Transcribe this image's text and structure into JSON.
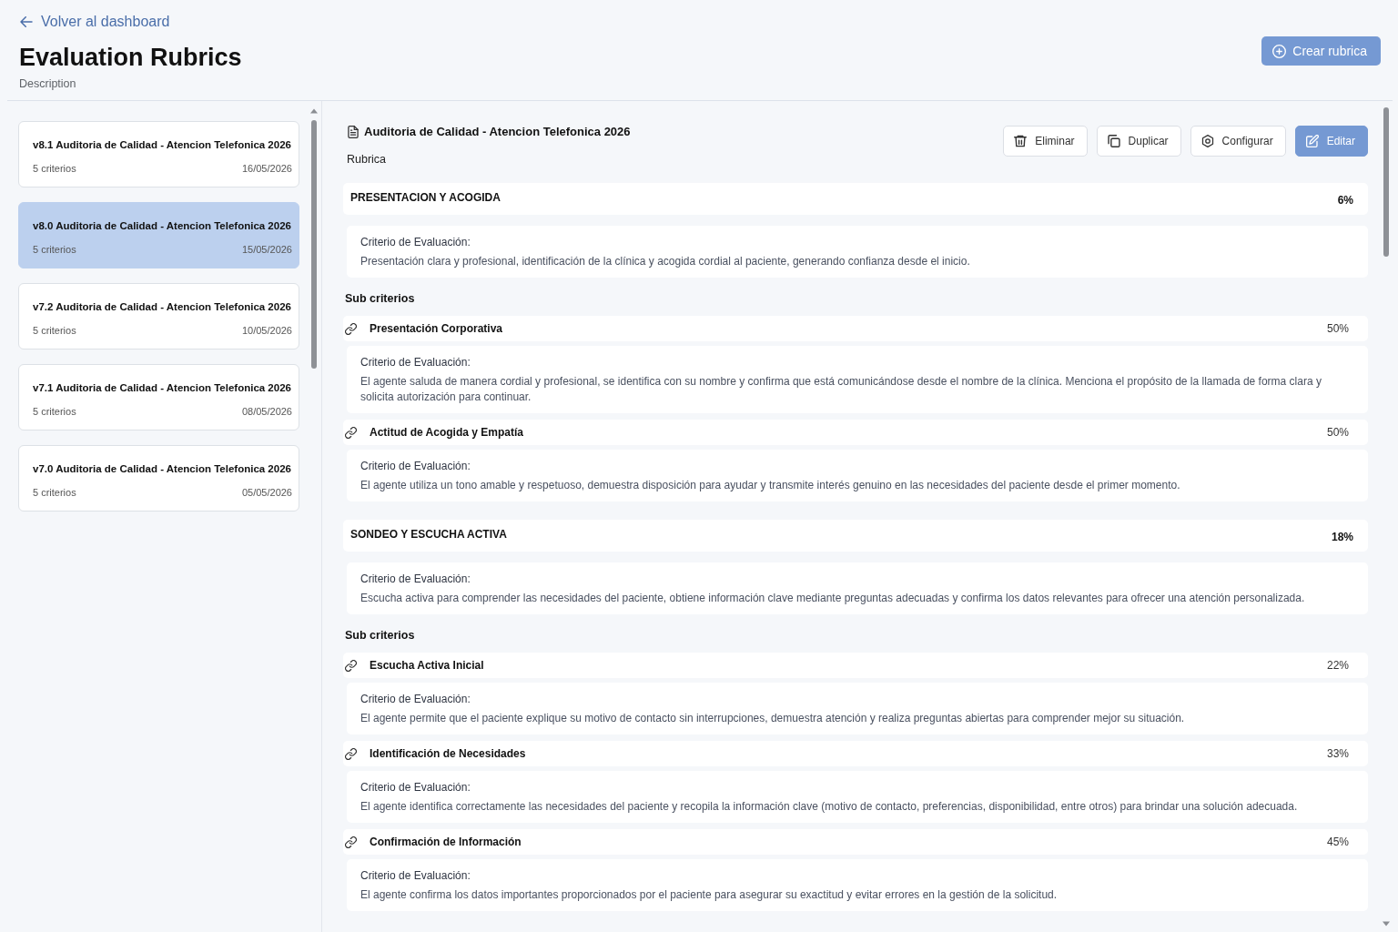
{
  "header": {
    "back_link": "Volver al dashboard",
    "title": "Evaluation Rubrics",
    "description": "Description",
    "create_button": "Crear rubrica"
  },
  "rubric_list": [
    {
      "title": "v8.1 Auditoria de Calidad - Atencion Telefonica 2026",
      "criteria_count": "5 criterios",
      "date": "16/05/2026",
      "selected": false
    },
    {
      "title": "v8.0 Auditoria de Calidad - Atencion Telefonica 2026",
      "criteria_count": "5 criterios",
      "date": "15/05/2026",
      "selected": true
    },
    {
      "title": "v7.2 Auditoria de Calidad - Atencion Telefonica 2026",
      "criteria_count": "5 criterios",
      "date": "10/05/2026",
      "selected": false
    },
    {
      "title": "v7.1 Auditoria de Calidad - Atencion Telefonica 2026",
      "criteria_count": "5 criterios",
      "date": "08/05/2026",
      "selected": false
    },
    {
      "title": "v7.0 Auditoria de Calidad - Atencion Telefonica 2026",
      "criteria_count": "5 criterios",
      "date": "05/05/2026",
      "selected": false
    }
  ],
  "detail": {
    "title": "Auditoria de Calidad - Atencion Telefonica 2026",
    "subtitle": "Rubrica",
    "actions": [
      {
        "label": "Eliminar",
        "kind": "delete",
        "primary": false
      },
      {
        "label": "Duplicar",
        "kind": "duplicate",
        "primary": false
      },
      {
        "label": "Configurar",
        "kind": "configure",
        "primary": false
      },
      {
        "label": "Editar",
        "kind": "edit",
        "primary": true
      }
    ],
    "criteria": [
      {
        "name": "PRESENTACION Y ACOGIDA",
        "weight": "6%",
        "criterion_label": "Criterio de Evaluación:",
        "criterion_text": "Presentación clara y profesional, identificación de la clínica y acogida cordial al paciente, generando confianza desde el inicio.",
        "subcriteria_heading": "Sub criterios",
        "subcriteria": [
          {
            "name": "Presentación Corporativa",
            "weight": "50%",
            "criterion_label": "Criterio de Evaluación:",
            "criterion_text": "El agente saluda de manera cordial y profesional, se identifica con su nombre y confirma que está comunicándose desde el nombre de la clínica. Menciona el propósito de la llamada de forma clara y solicita autorización para continuar."
          },
          {
            "name": "Actitud de Acogida y Empatía",
            "weight": "50%",
            "criterion_label": "Criterio de Evaluación:",
            "criterion_text": "El agente utiliza un tono amable y respetuoso, demuestra disposición para ayudar y transmite interés genuino en las necesidades del paciente desde el primer momento."
          }
        ]
      },
      {
        "name": "SONDEO Y ESCUCHA ACTIVA",
        "weight": "18%",
        "criterion_label": "Criterio de Evaluación:",
        "criterion_text": "Escucha activa para comprender las necesidades del paciente, obtiene información clave mediante preguntas adecuadas y confirma los datos relevantes para ofrecer una atención personalizada.",
        "subcriteria_heading": "Sub criterios",
        "subcriteria": [
          {
            "name": "Escucha Activa Inicial",
            "weight": "22%",
            "criterion_label": "Criterio de Evaluación:",
            "criterion_text": "El agente permite que el paciente explique su motivo de contacto sin interrupciones, demuestra atención y realiza preguntas abiertas para comprender mejor su situación."
          },
          {
            "name": "Identificación de Necesidades",
            "weight": "33%",
            "criterion_label": "Criterio de Evaluación:",
            "criterion_text": "El agente identifica correctamente las necesidades del paciente y recopila la información clave (motivo de contacto, preferencias, disponibilidad, entre otros) para brindar una solución adecuada."
          },
          {
            "name": "Confirmación de Información",
            "weight": "45%",
            "criterion_label": "Criterio de Evaluación:",
            "criterion_text": "El agente confirma los datos importantes proporcionados por el paciente para asegurar su exactitud y evitar errores en la gestión de la solicitud."
          }
        ]
      }
    ]
  }
}
